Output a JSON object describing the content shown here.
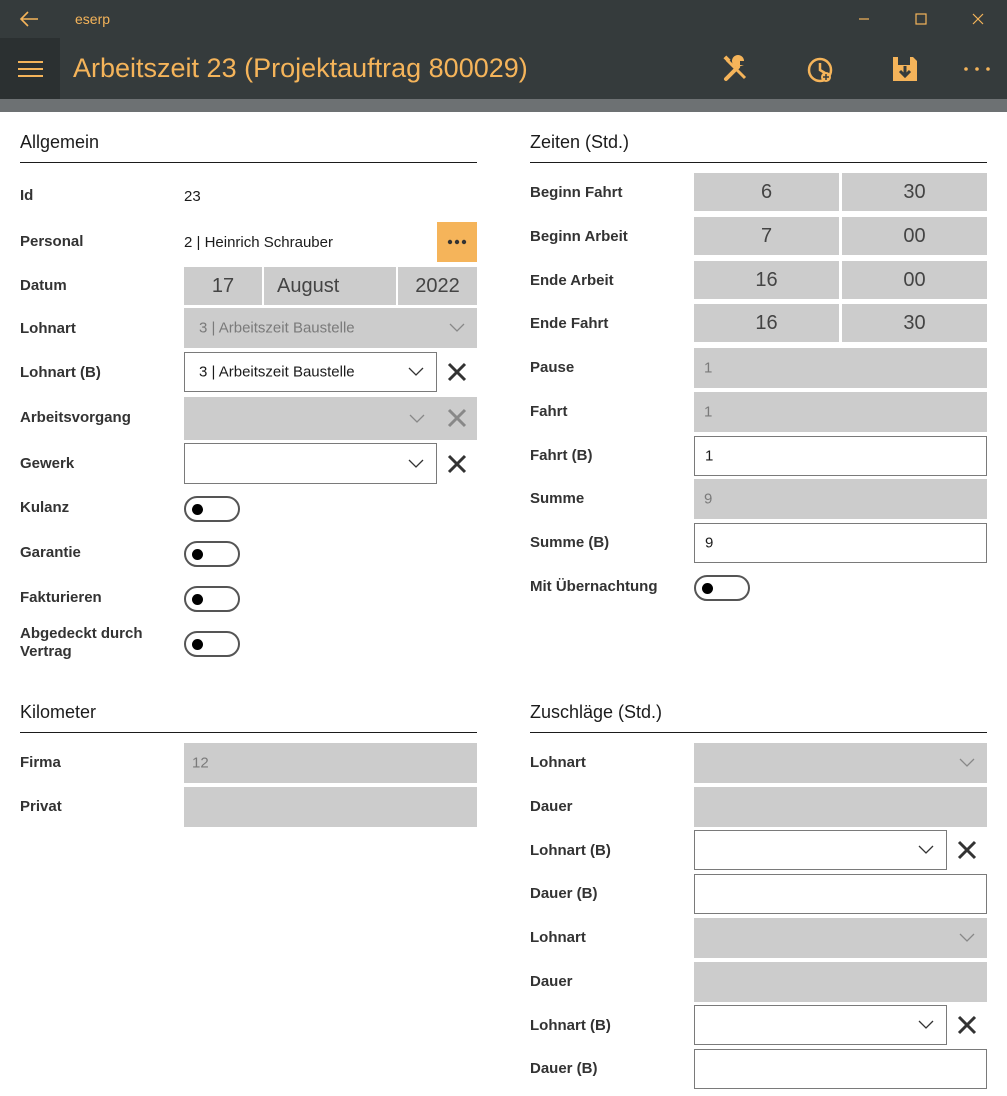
{
  "window": {
    "app_title": "eserp"
  },
  "header": {
    "title": "Arbeitszeit 23 (Projektauftrag 800029)"
  },
  "icons": {
    "back": "arrow-left-icon",
    "minimize": "minimize-icon",
    "maximize": "maximize-icon",
    "close": "close-icon",
    "menu": "hamburger-icon",
    "tools": "tools-icon",
    "clock": "clock-icon",
    "save": "save-icon",
    "more": "more-icon"
  },
  "colors": {
    "accent": "#f5b45a",
    "bar": "#353b3c",
    "disabled": "#cccccc"
  },
  "allgemein": {
    "title": "Allgemein",
    "id_label": "Id",
    "id_value": "23",
    "personal_label": "Personal",
    "personal_value": "2  |  Heinrich Schrauber",
    "personal_more": "•••",
    "datum_label": "Datum",
    "datum_day": "17",
    "datum_month": "August",
    "datum_year": "2022",
    "lohnart_label": "Lohnart",
    "lohnart_value": "3  |  Arbeitszeit Baustelle",
    "lohnart_b_label": "Lohnart (B)",
    "lohnart_b_value": "3  |  Arbeitszeit Baustelle",
    "arbeitsvorgang_label": "Arbeitsvorgang",
    "gewerk_label": "Gewerk",
    "kulanz_label": "Kulanz",
    "garantie_label": "Garantie",
    "fakturieren_label": "Fakturieren",
    "abgedeckt_label_1": "Abgedeckt durch",
    "abgedeckt_label_2": "Vertrag"
  },
  "zeiten": {
    "title": "Zeiten (Std.)",
    "beginn_fahrt_label": "Beginn Fahrt",
    "beginn_fahrt_h": "6",
    "beginn_fahrt_m": "30",
    "beginn_arbeit_label": "Beginn Arbeit",
    "beginn_arbeit_h": "7",
    "beginn_arbeit_m": "00",
    "ende_arbeit_label": "Ende Arbeit",
    "ende_arbeit_h": "16",
    "ende_arbeit_m": "00",
    "ende_fahrt_label": "Ende Fahrt",
    "ende_fahrt_h": "16",
    "ende_fahrt_m": "30",
    "pause_label": "Pause",
    "pause_value": "1",
    "fahrt_label": "Fahrt",
    "fahrt_value": "1",
    "fahrt_b_label": "Fahrt (B)",
    "fahrt_b_value": "1",
    "summe_label": "Summe",
    "summe_value": "9",
    "summe_b_label": "Summe (B)",
    "summe_b_value": "9",
    "uebernachtung_label": "Mit Übernachtung"
  },
  "kilometer": {
    "title": "Kilometer",
    "firma_label": "Firma",
    "firma_value": "12",
    "privat_label": "Privat"
  },
  "zuschlaege": {
    "title": "Zuschläge (Std.)",
    "lohnart_label": "Lohnart",
    "dauer_label": "Dauer",
    "lohnart_b_label": "Lohnart (B)",
    "dauer_b_label": "Dauer (B)"
  }
}
